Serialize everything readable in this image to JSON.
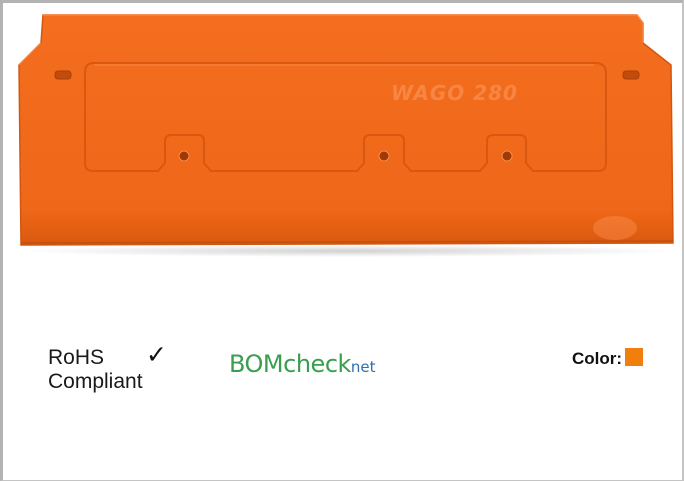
{
  "product": {
    "marking": "WAGO 280",
    "body_color": "#f26a1b",
    "body_shade": "#e05c10"
  },
  "compliance": {
    "rohs_line1": "RoHS",
    "rohs_line2": "Compliant",
    "check_symbol": "✓",
    "bomcheck_prefix": "BOM",
    "bomcheck_check": "check",
    "bomcheck_suffix": "net"
  },
  "color": {
    "label": "Color:",
    "swatch": "#f07f0e"
  }
}
